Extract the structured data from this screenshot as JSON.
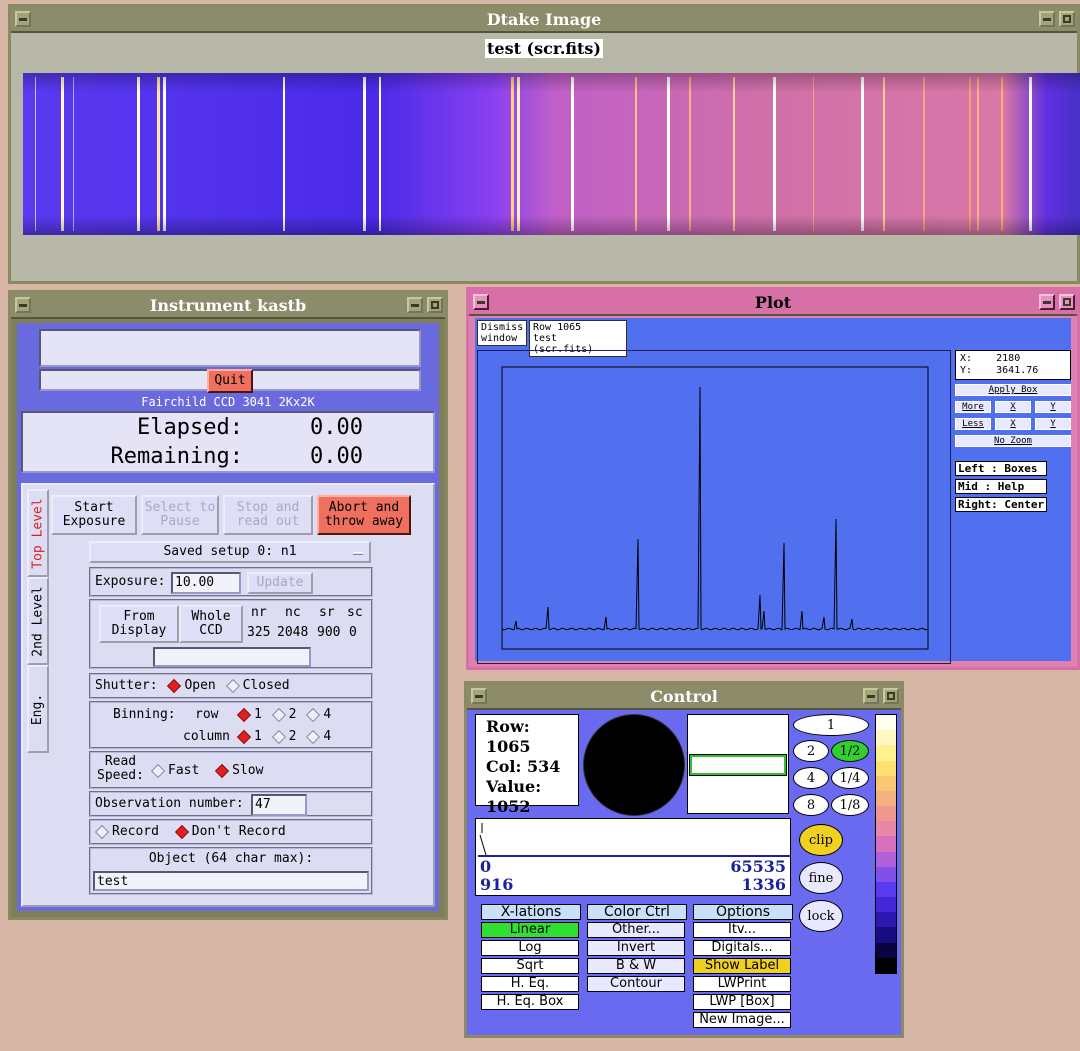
{
  "dtake": {
    "window_title": "Dtake Image",
    "image_title": "test (scr.fits)"
  },
  "instrument": {
    "window_title": "Instrument kastb",
    "quit_label": "Quit",
    "ccd_label": "Fairchild CCD 3041 2Kx2K",
    "elapsed_label": "Elapsed:",
    "elapsed_value": "0.00",
    "remaining_label": "Remaining:",
    "remaining_value": "0.00",
    "tabs": [
      "Top Level",
      "2nd Level",
      "Eng."
    ],
    "start_line1": "Start",
    "start_line2": "Exposure",
    "select_line1": "Select to",
    "select_line2": "Pause",
    "stop_line1": "Stop and",
    "stop_line2": "read out",
    "abort_line1": "Abort and",
    "abort_line2": "throw away",
    "saved_setup": "Saved setup 0: n1",
    "exposure_label": "Exposure:",
    "exposure_value": "10.00",
    "update_label": "Update",
    "from_display_1": "From",
    "from_display_2": "Display",
    "whole_ccd_1": "Whole",
    "whole_ccd_2": "CCD",
    "region_headers": [
      "nr",
      "nc",
      "sr",
      "sc"
    ],
    "region_values": [
      "325",
      "2048",
      "900",
      "0"
    ],
    "shutter_label": "Shutter:",
    "shutter_open": "Open",
    "shutter_closed": "Closed",
    "binning_label": "Binning:",
    "row_label": "row",
    "column_label": "column",
    "bin_options": [
      "1",
      "2",
      "4"
    ],
    "read_speed_1": "Read",
    "read_speed_2": "Speed:",
    "fast": "Fast",
    "slow": "Slow",
    "obs_label": "Observation number:",
    "obs_value": "47",
    "record": "Record",
    "dont_record": "Don't Record",
    "object_label": "Object (64 char max):",
    "object_value": "test"
  },
  "plot": {
    "window_title": "Plot",
    "dismiss_1": "Dismiss",
    "dismiss_2": "window",
    "row_label": "Row 1065",
    "file_label": "test (scr.fits)",
    "x_label": "X:",
    "x_value": "2180",
    "y_label": "Y:",
    "y_value": "3641.76",
    "apply_box": "Apply Box",
    "more": "More",
    "less": "Less",
    "x_btn": "X",
    "y_btn": "Y",
    "no_zoom": "No Zoom",
    "help_left": "Left : Boxes",
    "help_mid": "Mid  : Help",
    "help_right": "Right: Center"
  },
  "control": {
    "window_title": "Control",
    "row_text": "Row: 1065",
    "col_text": "Col: 534",
    "value_label": "Value:",
    "value_value": "1052",
    "zoom_buttons": [
      "1",
      "2",
      "1/2",
      "4",
      "1/4",
      "8",
      "1/8"
    ],
    "clip": "clip",
    "fine": "fine",
    "lock": "lock",
    "hist_min": "0",
    "hist_max": "65535",
    "hist_low": "916",
    "hist_high": "1336",
    "xlations_head": "X-lations",
    "xlations": [
      "Linear",
      "Log",
      "Sqrt",
      "H. Eq.",
      "H. Eq. Box"
    ],
    "colorctrl_head": "Color Ctrl",
    "colorctrl": [
      "Other...",
      "Invert",
      "B & W",
      "Contour"
    ],
    "options_head": "Options",
    "options": [
      "Itv...",
      "Digitals...",
      "Show Label",
      "LWPrint",
      "LWP [Box]",
      "New Image..."
    ]
  },
  "colors": {
    "desktop": "#d7b6a6",
    "panel_blue": "#6a6af0",
    "plot_bg": "#5070f0",
    "plot_frame": "#e080b0",
    "accent_red": "#f07060",
    "active_green": "#30d030",
    "active_yellow": "#f0d020"
  }
}
